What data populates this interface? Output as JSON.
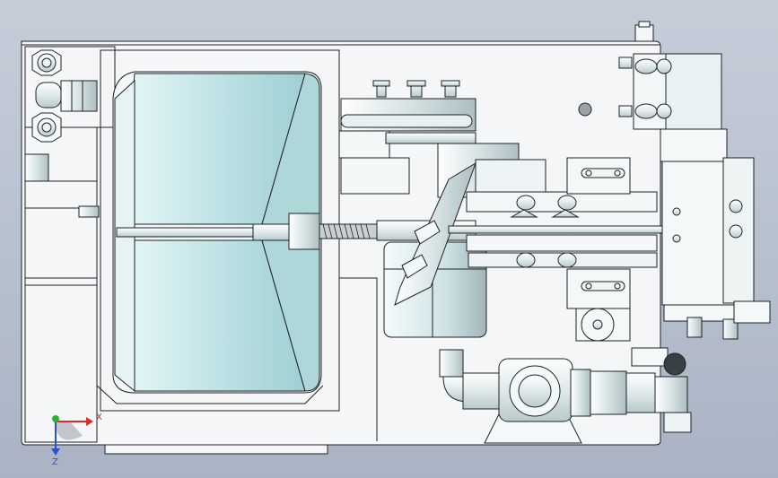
{
  "viewport": {
    "background_top": "#c6cdd9",
    "background_bottom": "#aab3c3"
  },
  "colors": {
    "housing": "#f4f6f8",
    "stroke": "#1f2226",
    "tank_glass": "#bfe3e6",
    "tank_glass_light": "#e2f4f5",
    "brass": "#cfd8d9",
    "axis_x": "#e0282b",
    "axis_y": "#2fae3a",
    "axis_z": "#2b4fd6"
  },
  "triad": {
    "x_label": "X",
    "z_label": "Z"
  }
}
